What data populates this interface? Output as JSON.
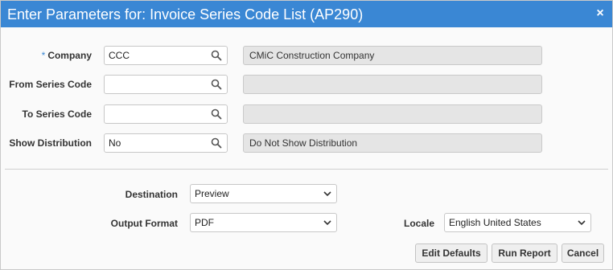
{
  "dialog": {
    "title": "Enter Parameters for: Invoice Series Code List (AP290)",
    "close_glyph": "×"
  },
  "params": [
    {
      "label": "Company",
      "required": "*",
      "value": "CCC",
      "description": "CMiC Construction Company"
    },
    {
      "label": "From Series Code",
      "required": "",
      "value": "",
      "description": ""
    },
    {
      "label": "To Series Code",
      "required": "",
      "value": "",
      "description": ""
    },
    {
      "label": "Show Distribution",
      "required": "",
      "value": "No",
      "description": "Do Not Show Distribution"
    }
  ],
  "output": {
    "destination_label": "Destination",
    "destination_value": "Preview",
    "format_label": "Output Format",
    "format_value": "PDF",
    "locale_label": "Locale",
    "locale_value": "English United States"
  },
  "buttons": {
    "edit_defaults": "Edit Defaults",
    "run_report": "Run Report",
    "cancel": "Cancel"
  },
  "colors": {
    "title_bar": "#3a87d4",
    "required_marker": "#3a87d4",
    "description_bg": "#e5e5e5"
  },
  "icons": {
    "lookup": "search-icon",
    "dropdown": "chevron-down-icon",
    "close": "close-icon"
  }
}
